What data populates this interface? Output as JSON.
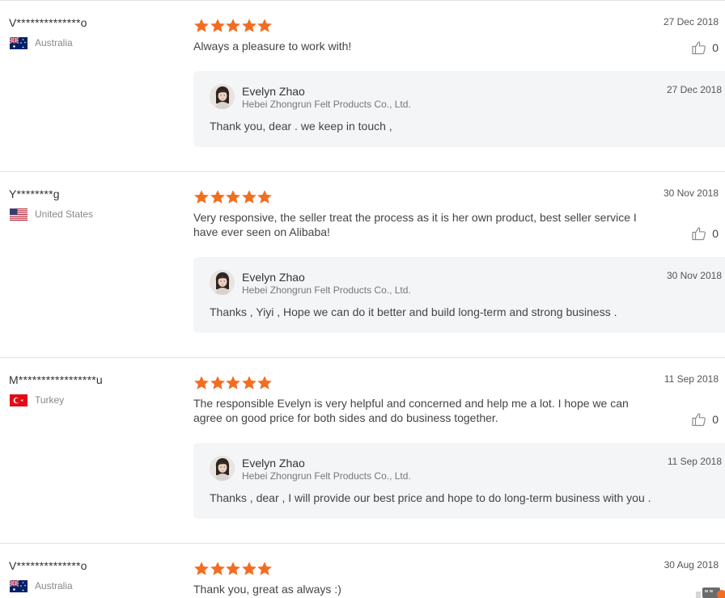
{
  "reviews": [
    {
      "buyer": "V**************o",
      "country": "Australia",
      "flag": "australia",
      "rating": 5,
      "date": "27 Dec 2018",
      "text": "Always a pleasure to work with!",
      "likes": "0",
      "reply": {
        "name": "Evelyn Zhao",
        "company": "Hebei Zhongrun Felt Products Co., Ltd.",
        "date": "27 Dec 2018",
        "text": "Thank you, dear . we keep in touch ,"
      }
    },
    {
      "buyer": "Y********g",
      "country": "United States",
      "flag": "united-states",
      "rating": 5,
      "date": "30 Nov 2018",
      "text": "Very responsive, the seller treat the process as it is her own product, best seller service I have ever seen on Alibaba!",
      "likes": "0",
      "reply": {
        "name": "Evelyn Zhao",
        "company": "Hebei Zhongrun Felt Products Co., Ltd.",
        "date": "30 Nov 2018",
        "text": "Thanks , Yiyi , Hope we can do it better and build long-term and strong business ."
      }
    },
    {
      "buyer": "M*****************u",
      "country": "Turkey",
      "flag": "turkey",
      "rating": 5,
      "date": "11 Sep 2018",
      "text": "The responsible Evelyn is very helpful and concerned and help me a lot. I hope we can agree on good price for both sides and do business together.",
      "likes": "0",
      "reply": {
        "name": "Evelyn Zhao",
        "company": "Hebei Zhongrun Felt Products Co., Ltd.",
        "date": "11 Sep 2018",
        "text": "Thanks , dear , I will provide our best price and hope to do long-term business with you ."
      }
    },
    {
      "buyer": "V**************o",
      "country": "Australia",
      "flag": "australia",
      "rating": 5,
      "date": "30 Aug 2018",
      "text": "Thank you, great as always :)",
      "likes": "",
      "reply": null
    }
  ],
  "icons": {
    "star": "star-icon",
    "like": "thumbs-up-icon",
    "avatar": "seller-avatar"
  },
  "colors": {
    "star": "#f36d21",
    "reply_bg": "#f4f5f7",
    "divider": "#e3e3e3"
  }
}
